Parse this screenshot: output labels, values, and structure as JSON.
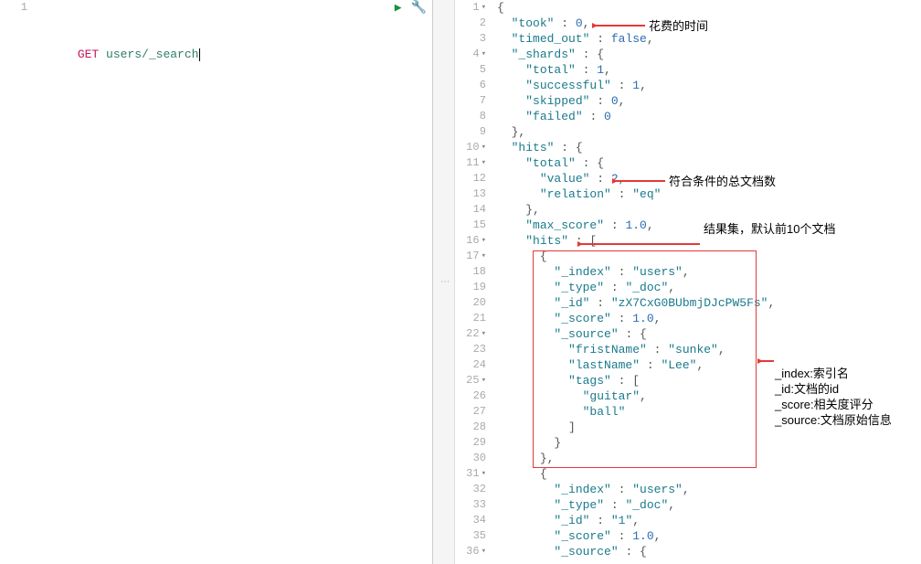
{
  "left": {
    "line1": {
      "method": "GET",
      "path": "users/_search"
    }
  },
  "right": {
    "gutters": [
      "1",
      "2",
      "3",
      "4",
      "5",
      "6",
      "7",
      "8",
      "9",
      "10",
      "11",
      "12",
      "13",
      "14",
      "15",
      "16",
      "17",
      "18",
      "19",
      "20",
      "21",
      "22",
      "23",
      "24",
      "25",
      "26",
      "27",
      "28",
      "29",
      "30",
      "31",
      "32",
      "33",
      "34",
      "35",
      "36"
    ],
    "fold_lines": [
      1,
      4,
      10,
      11,
      16,
      17,
      22,
      25,
      31,
      36
    ],
    "highlight_line": 20,
    "tokens": [
      [
        [
          "punc",
          "{"
        ]
      ],
      [
        [
          "sp",
          "  "
        ],
        [
          "key",
          "\"took\""
        ],
        [
          "punc",
          " : "
        ],
        [
          "num",
          "0"
        ],
        [
          "punc",
          ","
        ]
      ],
      [
        [
          "sp",
          "  "
        ],
        [
          "key",
          "\"timed_out\""
        ],
        [
          "punc",
          " : "
        ],
        [
          "bool",
          "false"
        ],
        [
          "punc",
          ","
        ]
      ],
      [
        [
          "sp",
          "  "
        ],
        [
          "key",
          "\"_shards\""
        ],
        [
          "punc",
          " : {"
        ]
      ],
      [
        [
          "sp",
          "    "
        ],
        [
          "key",
          "\"total\""
        ],
        [
          "punc",
          " : "
        ],
        [
          "num",
          "1"
        ],
        [
          "punc",
          ","
        ]
      ],
      [
        [
          "sp",
          "    "
        ],
        [
          "key",
          "\"successful\""
        ],
        [
          "punc",
          " : "
        ],
        [
          "num",
          "1"
        ],
        [
          "punc",
          ","
        ]
      ],
      [
        [
          "sp",
          "    "
        ],
        [
          "key",
          "\"skipped\""
        ],
        [
          "punc",
          " : "
        ],
        [
          "num",
          "0"
        ],
        [
          "punc",
          ","
        ]
      ],
      [
        [
          "sp",
          "    "
        ],
        [
          "key",
          "\"failed\""
        ],
        [
          "punc",
          " : "
        ],
        [
          "num",
          "0"
        ]
      ],
      [
        [
          "sp",
          "  "
        ],
        [
          "punc",
          "},"
        ]
      ],
      [
        [
          "sp",
          "  "
        ],
        [
          "key",
          "\"hits\""
        ],
        [
          "punc",
          " : {"
        ]
      ],
      [
        [
          "sp",
          "    "
        ],
        [
          "key",
          "\"total\""
        ],
        [
          "punc",
          " : {"
        ]
      ],
      [
        [
          "sp",
          "      "
        ],
        [
          "key",
          "\"value\""
        ],
        [
          "punc",
          " : "
        ],
        [
          "num",
          "2"
        ],
        [
          "punc",
          ","
        ]
      ],
      [
        [
          "sp",
          "      "
        ],
        [
          "key",
          "\"relation\""
        ],
        [
          "punc",
          " : "
        ],
        [
          "str",
          "\"eq\""
        ]
      ],
      [
        [
          "sp",
          "    "
        ],
        [
          "punc",
          "},"
        ]
      ],
      [
        [
          "sp",
          "    "
        ],
        [
          "key",
          "\"max_score\""
        ],
        [
          "punc",
          " : "
        ],
        [
          "num",
          "1.0"
        ],
        [
          "punc",
          ","
        ]
      ],
      [
        [
          "sp",
          "    "
        ],
        [
          "key",
          "\"hits\""
        ],
        [
          "punc",
          " : ["
        ]
      ],
      [
        [
          "sp",
          "      "
        ],
        [
          "punc",
          "{"
        ]
      ],
      [
        [
          "sp",
          "        "
        ],
        [
          "key",
          "\"_index\""
        ],
        [
          "punc",
          " : "
        ],
        [
          "str",
          "\"users\""
        ],
        [
          "punc",
          ","
        ]
      ],
      [
        [
          "sp",
          "        "
        ],
        [
          "key",
          "\"_type\""
        ],
        [
          "punc",
          " : "
        ],
        [
          "str",
          "\"_doc\""
        ],
        [
          "punc",
          ","
        ]
      ],
      [
        [
          "sp",
          "        "
        ],
        [
          "key",
          "\"_id\""
        ],
        [
          "punc",
          " : "
        ],
        [
          "str",
          "\"zX7CxG0BUbmjDJcPW5Fs\""
        ],
        [
          "punc",
          ","
        ]
      ],
      [
        [
          "sp",
          "        "
        ],
        [
          "key",
          "\"_score\""
        ],
        [
          "punc",
          " : "
        ],
        [
          "num",
          "1.0"
        ],
        [
          "punc",
          ","
        ]
      ],
      [
        [
          "sp",
          "        "
        ],
        [
          "key",
          "\"_source\""
        ],
        [
          "punc",
          " : {"
        ]
      ],
      [
        [
          "sp",
          "          "
        ],
        [
          "key",
          "\"fristName\""
        ],
        [
          "punc",
          " : "
        ],
        [
          "str",
          "\"sunke\""
        ],
        [
          "punc",
          ","
        ]
      ],
      [
        [
          "sp",
          "          "
        ],
        [
          "key",
          "\"lastName\""
        ],
        [
          "punc",
          " : "
        ],
        [
          "str",
          "\"Lee\""
        ],
        [
          "punc",
          ","
        ]
      ],
      [
        [
          "sp",
          "          "
        ],
        [
          "key",
          "\"tags\""
        ],
        [
          "punc",
          " : ["
        ]
      ],
      [
        [
          "sp",
          "            "
        ],
        [
          "str",
          "\"guitar\""
        ],
        [
          "punc",
          ","
        ]
      ],
      [
        [
          "sp",
          "            "
        ],
        [
          "str",
          "\"ball\""
        ]
      ],
      [
        [
          "sp",
          "          "
        ],
        [
          "punc",
          "]"
        ]
      ],
      [
        [
          "sp",
          "        "
        ],
        [
          "punc",
          "}"
        ]
      ],
      [
        [
          "sp",
          "      "
        ],
        [
          "punc",
          "},"
        ]
      ],
      [
        [
          "sp",
          "      "
        ],
        [
          "punc",
          "{"
        ]
      ],
      [
        [
          "sp",
          "        "
        ],
        [
          "key",
          "\"_index\""
        ],
        [
          "punc",
          " : "
        ],
        [
          "str",
          "\"users\""
        ],
        [
          "punc",
          ","
        ]
      ],
      [
        [
          "sp",
          "        "
        ],
        [
          "key",
          "\"_type\""
        ],
        [
          "punc",
          " : "
        ],
        [
          "str",
          "\"_doc\""
        ],
        [
          "punc",
          ","
        ]
      ],
      [
        [
          "sp",
          "        "
        ],
        [
          "key",
          "\"_id\""
        ],
        [
          "punc",
          " : "
        ],
        [
          "str",
          "\"1\""
        ],
        [
          "punc",
          ","
        ]
      ],
      [
        [
          "sp",
          "        "
        ],
        [
          "key",
          "\"_score\""
        ],
        [
          "punc",
          " : "
        ],
        [
          "num",
          "1.0"
        ],
        [
          "punc",
          ","
        ]
      ],
      [
        [
          "sp",
          "        "
        ],
        [
          "key",
          "\"_source\""
        ],
        [
          "punc",
          " : {"
        ]
      ]
    ]
  },
  "annotations": {
    "a1": "花费的时间",
    "a2": "符合条件的总文档数",
    "a3": "结果集，默认前10个文档",
    "a4": "_index:索引名\n_id:文档的id\n_score:相关度评分\n_source:文档原始信息"
  }
}
